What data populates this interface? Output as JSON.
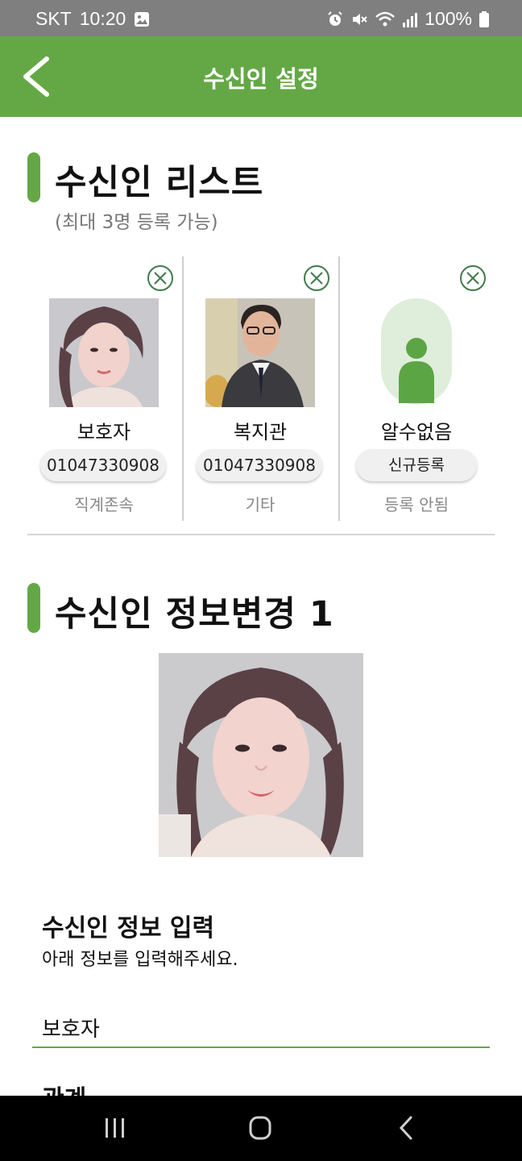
{
  "status_bar": {
    "carrier": "SKT",
    "time": "10:20",
    "battery": "100%",
    "icons": [
      "image-icon",
      "alarm-icon",
      "mute-icon",
      "wifi-icon",
      "signal-icon",
      "battery-icon"
    ]
  },
  "app_bar": {
    "title": "수신인 설정",
    "back_icon": "back-arrow-icon"
  },
  "list_section": {
    "title": "수신인 리스트",
    "subtitle": "(최대 3명 등록 가능)"
  },
  "recipients": [
    {
      "name": "보호자",
      "phone": "01047330908",
      "relation": "직계존속",
      "avatar": "photo-woman"
    },
    {
      "name": "복지관",
      "phone": "01047330908",
      "relation": "기타",
      "avatar": "photo-man"
    },
    {
      "name": "알수없음",
      "phone": "신규등록",
      "relation": "등록 안됨",
      "avatar": "person-placeholder-icon"
    }
  ],
  "edit_section": {
    "title": "수신인 정보변경 1"
  },
  "form": {
    "title": "수신인 정보 입력",
    "description": "아래 정보를 입력해주세요.",
    "name_value": "보호자",
    "next_label_partial": "관계"
  },
  "colors": {
    "accent": "#64a846",
    "status_bar": "#7f7f7f",
    "close_icon": "#3f7a4c",
    "placeholder_bg": "#dfeddb"
  },
  "nav_bar": {
    "icons": [
      "recent-apps-icon",
      "home-icon",
      "back-icon"
    ]
  }
}
